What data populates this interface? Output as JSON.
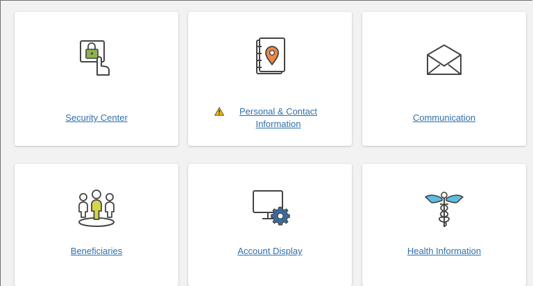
{
  "tiles": [
    {
      "label": "Security Center",
      "icon": "lock-hand-icon"
    },
    {
      "label": "Personal & Contact Information",
      "label_line1": "Personal & Contact",
      "label_line2": "Information",
      "icon": "address-book-icon",
      "warning": "warning-icon"
    },
    {
      "label": "Communication",
      "icon": "envelope-icon"
    },
    {
      "label": "Beneficiaries",
      "icon": "people-group-icon"
    },
    {
      "label": "Account Display",
      "icon": "monitor-gear-icon"
    },
    {
      "label": "Health Information",
      "icon": "caduceus-icon"
    }
  ],
  "colors": {
    "link": "#2f6fa8",
    "accent_green": "#8ab34d",
    "accent_yellow": "#d4d64a",
    "accent_orange": "#e9874a",
    "accent_blue": "#5bbfe0",
    "accent_gear": "#3c6a97",
    "warning": "#f2c200"
  }
}
